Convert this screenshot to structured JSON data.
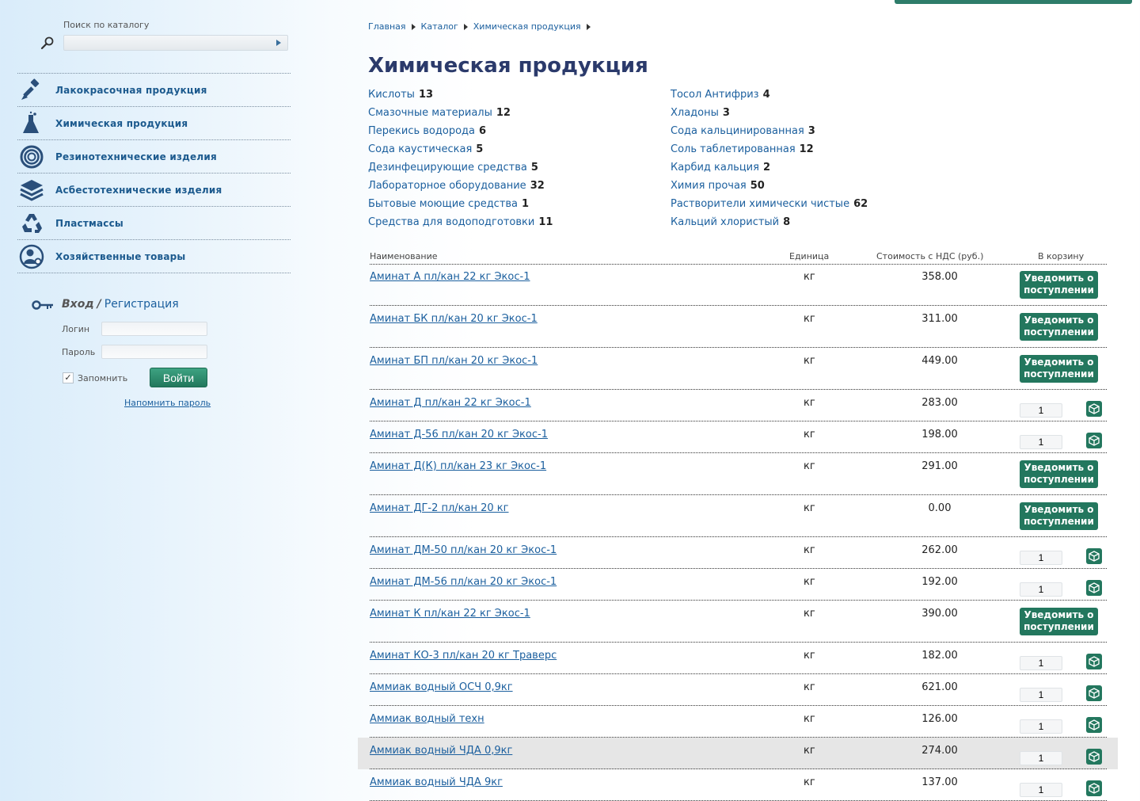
{
  "search": {
    "label": "Поиск по каталогу",
    "placeholder": ""
  },
  "categories": [
    {
      "label": "Лакокрасочная продукция",
      "icon": "paint-brush-icon"
    },
    {
      "label": "Химическая продукция",
      "icon": "flask-icon"
    },
    {
      "label": "Резинотехнические изделия",
      "icon": "rubber-ring-icon"
    },
    {
      "label": "Асбестотехнические изделия",
      "icon": "layers-icon"
    },
    {
      "label": "Пластмассы",
      "icon": "recycle-icon"
    },
    {
      "label": "Хозяйственные товары",
      "icon": "household-icon"
    }
  ],
  "login": {
    "title": "Вход",
    "separator": "/",
    "register": "Регистрация",
    "login_label": "Логин",
    "password_label": "Пароль",
    "remember": "Запомнить",
    "remember_checked": true,
    "submit": "Войти",
    "forgot": "Напомнить пароль"
  },
  "breadcrumb": [
    "Главная",
    "Каталог",
    "Химическая продукция"
  ],
  "page_title": "Химическая продукция",
  "subcategories": [
    {
      "name": "Кислоты",
      "count": "13"
    },
    {
      "name": "Смазочные материалы",
      "count": "12"
    },
    {
      "name": "Перекись водорода",
      "count": "6"
    },
    {
      "name": "Сода каустическая",
      "count": "5"
    },
    {
      "name": "Дезинфецирующие средства",
      "count": "5"
    },
    {
      "name": "Лабораторное оборудование",
      "count": "32"
    },
    {
      "name": "Бытовые моющие средства",
      "count": "1"
    },
    {
      "name": "Средства для водоподготовки",
      "count": "11"
    },
    {
      "name": "Тосол Антифриз",
      "count": "4"
    },
    {
      "name": "Хладоны",
      "count": "3"
    },
    {
      "name": "Сода кальцинированная",
      "count": "3"
    },
    {
      "name": "Соль таблетированная",
      "count": "12"
    },
    {
      "name": "Карбид кальция",
      "count": "2"
    },
    {
      "name": "Химия прочая",
      "count": "50"
    },
    {
      "name": "Растворители химически чистые",
      "count": "62"
    },
    {
      "name": "Кальций хлористый",
      "count": "8"
    }
  ],
  "table": {
    "headers": {
      "name": "Наименование",
      "unit": "Единица",
      "price": "Стоимость с НДС (руб.)",
      "cart": "В корзину"
    },
    "notify_label": "Уведомить о поступлении",
    "rows": [
      {
        "name": "Аминат А пл/кан 22 кг Экос-1",
        "unit": "кг",
        "price": "358.00",
        "available": false
      },
      {
        "name": "Аминат БК пл/кан 20 кг Экос-1",
        "unit": "кг",
        "price": "311.00",
        "available": false
      },
      {
        "name": "Аминат БП пл/кан 20 кг Экос-1",
        "unit": "кг",
        "price": "449.00",
        "available": false
      },
      {
        "name": "Аминат Д пл/кан 22 кг Экос-1",
        "unit": "кг",
        "price": "283.00",
        "available": true,
        "qty": "1"
      },
      {
        "name": "Аминат Д-56 пл/кан 20 кг Экос-1",
        "unit": "кг",
        "price": "198.00",
        "available": true,
        "qty": "1"
      },
      {
        "name": "Аминат Д(К) пл/кан 23 кг Экос-1",
        "unit": "кг",
        "price": "291.00",
        "available": false
      },
      {
        "name": "Аминат ДГ-2 пл/кан 20 кг",
        "unit": "кг",
        "price": "0.00",
        "available": false
      },
      {
        "name": "Аминат ДМ-50 пл/кан 20 кг Экос-1",
        "unit": "кг",
        "price": "262.00",
        "available": true,
        "qty": "1"
      },
      {
        "name": "Аминат ДМ-56 пл/кан 20 кг Экос-1",
        "unit": "кг",
        "price": "192.00",
        "available": true,
        "qty": "1"
      },
      {
        "name": "Аминат К пл/кан 22 кг Экос-1",
        "unit": "кг",
        "price": "390.00",
        "available": false
      },
      {
        "name": "Аминат КО-3 пл/кан 20 кг Траверс",
        "unit": "кг",
        "price": "182.00",
        "available": true,
        "qty": "1"
      },
      {
        "name": "Аммиак водный ОСЧ 0,9кг",
        "unit": "кг",
        "price": "621.00",
        "available": true,
        "qty": "1"
      },
      {
        "name": "Аммиак водный техн",
        "unit": "кг",
        "price": "126.00",
        "available": true,
        "qty": "1"
      },
      {
        "name": "Аммиак водный ЧДА 0,9кг",
        "unit": "кг",
        "price": "274.00",
        "available": true,
        "qty": "1",
        "highlighted": true
      },
      {
        "name": "Аммиак водный ЧДА 9кг",
        "unit": "кг",
        "price": "137.00",
        "available": true,
        "qty": "1"
      }
    ]
  },
  "colors": {
    "accent": "#23775e",
    "link": "#1b5f9e",
    "title": "#2b3a6b"
  }
}
